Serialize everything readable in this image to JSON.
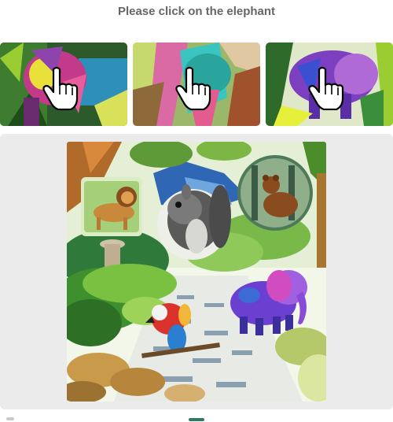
{
  "header": {
    "instruction": "Please click on the elephant"
  },
  "thumbnails": [
    {
      "icon": "pointer-hand-icon"
    },
    {
      "icon": "pointer-hand-icon"
    },
    {
      "icon": "pointer-hand-icon"
    }
  ],
  "colors": {
    "title_text": "#666666",
    "panel_bg": "#ebebeb",
    "accent": "#2f7a66"
  }
}
